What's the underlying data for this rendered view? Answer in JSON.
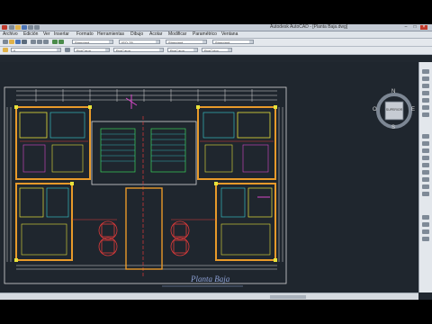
{
  "window": {
    "title": "Autodesk AutoCAD - [Planta Baja.dwg]",
    "controls": [
      "–",
      "□",
      "×"
    ]
  },
  "menu": [
    "Archivo",
    "Edición",
    "Ver",
    "Insertar",
    "Formato",
    "Herramientas",
    "Dibujo",
    "Acotar",
    "Modificar",
    "Paramétrico",
    "Ventana"
  ],
  "toolbar": {
    "style_text": "Standard",
    "style_dim": "ISO-25",
    "style_table": "Standard",
    "style_mleader": "Standard",
    "layer": "0",
    "color": "PorCapa",
    "linetype": "PorCapa",
    "lineweight": "PorCapa",
    "plotstyle": "PorColor"
  },
  "viewcube": {
    "face": "SUPERIOR",
    "north": "N",
    "south": "S",
    "east": "E",
    "west": "O"
  },
  "drawing": {
    "title": "Planta Baja"
  },
  "colors": {
    "canvas": "#1f262e",
    "wall": "#e89a2a",
    "yellow": "#e7e23a",
    "cyan": "#39d0d6",
    "red": "#e03a3a",
    "magenta": "#d748c8",
    "green": "#3bd35a",
    "white": "#d8d8d8"
  },
  "icons": [
    "new-icon",
    "open-icon",
    "save-icon",
    "print-icon",
    "undo-icon",
    "redo-icon",
    "pan-icon",
    "zoom-icon",
    "viewcube-icon",
    "ucs-icon"
  ]
}
